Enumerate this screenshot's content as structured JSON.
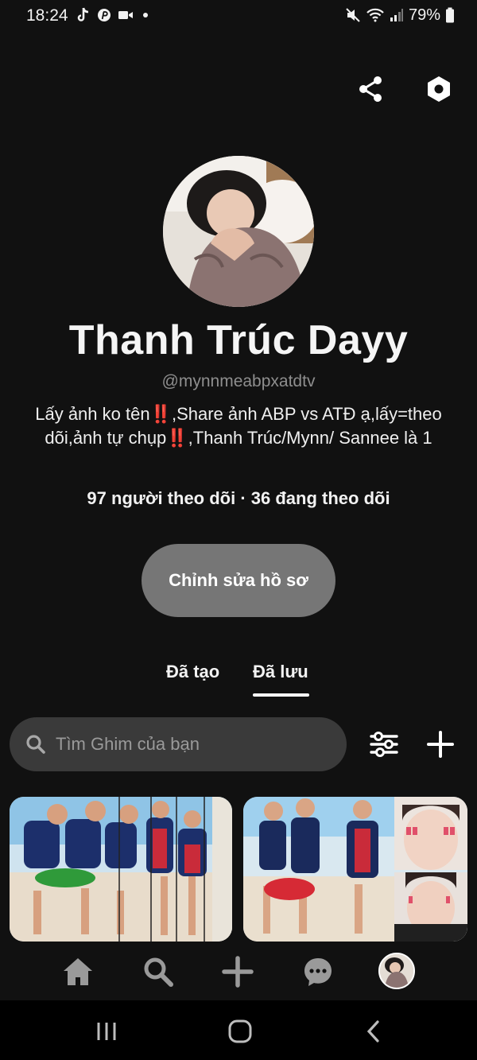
{
  "status_bar": {
    "time": "18:24",
    "battery": "79%",
    "icons_left": [
      "tiktok-icon",
      "pinterest-icon",
      "video-icon",
      "dot-icon"
    ],
    "icons_right": [
      "mute-icon",
      "wifi-icon",
      "signal-icon",
      "battery-icon"
    ]
  },
  "top_actions": {
    "share_icon": "share-icon",
    "settings_icon": "settings-hex-icon"
  },
  "profile": {
    "name": "Thanh Trúc Dayy",
    "handle": "@mynnmeabpxatdtv",
    "bio": "Lấy ảnh ko tên‼️,Share ảnh ABP vs ATĐ ạ,lấy=theo dõi,ảnh tự chụp‼️,Thanh Trúc/Mynn/ Sannee là 1",
    "stats": "97 người theo dõi · 36 đang theo dõi",
    "edit_button": "Chỉnh sửa hồ sơ"
  },
  "tabs": [
    {
      "label": "Đã tạo",
      "active": false
    },
    {
      "label": "Đã lưu",
      "active": true
    }
  ],
  "search": {
    "placeholder": "Tìm Ghim của bạn"
  },
  "pins": [
    {
      "watermark": ""
    },
    {
      "watermark": ""
    }
  ],
  "bottom_nav": [
    "home-icon",
    "search-icon",
    "create-icon",
    "messages-icon",
    "profile-avatar"
  ],
  "system_nav": [
    "recents-icon",
    "home-circle-icon",
    "back-icon"
  ],
  "colors": {
    "background": "#111111",
    "edit_button": "#767676",
    "search_bg": "#3a3a3a",
    "muted_text": "#8e8e8e"
  }
}
